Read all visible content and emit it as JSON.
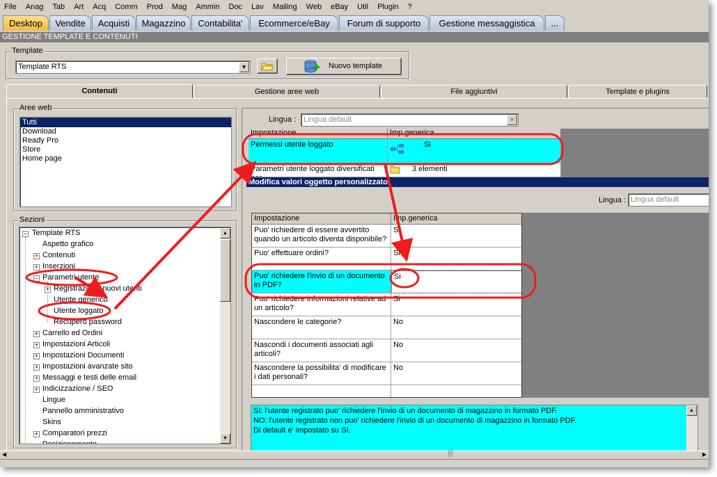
{
  "menu": [
    "File",
    "Anag",
    "Tab",
    "Art",
    "Acq",
    "Comm",
    "Prod",
    "Mag",
    "Ammin",
    "Doc",
    "Lav",
    "Mailing",
    "Web",
    "eBay",
    "Util",
    "Plugin",
    "?"
  ],
  "tabs": [
    "Desktop",
    "Vendite",
    "Acquisti",
    "Magazzino",
    "Contabilita'",
    "Ecommerce/eBay",
    "Forum di supporto",
    "Gestione messaggistica",
    "..."
  ],
  "section_title": "GESTIONE TEMPLATE E CONTENUTI",
  "template": {
    "legend": "Template",
    "value": "Template RTS",
    "new_button": "Nuovo template"
  },
  "page_tabs": [
    "Contenuti",
    "Gestione aree web",
    "File aggiuntivi",
    "Template e plugins"
  ],
  "aree_web": {
    "legend": "Aree web",
    "items": [
      "Tutti",
      "Download",
      "Ready Pro",
      "Store",
      "Home page"
    ]
  },
  "sezioni": {
    "legend": "Sezioni",
    "root": "Template RTS",
    "nodes": [
      "Aspetto grafico",
      "Contenuti",
      "Inserzioni",
      "Parametri utente",
      "Registrazione nuovi utenti",
      "Utente generico",
      "Utente loggato",
      "Recupero password",
      "Carrello ed Ordini",
      "Impostazioni Articoli",
      "Impostazioni Documenti",
      "Impostazioni avanzate sito",
      "Messaggi e testi delle email",
      "Indicizzazione / SEO",
      "Lingue",
      "Pannello amministrativo",
      "Skins",
      "Comparatori prezzi",
      "Posizionamento"
    ]
  },
  "upper": {
    "lingua_label": "Lingua :",
    "lingua_value": "Lingua default",
    "headers": [
      "Impostazione",
      "Imp.generica"
    ],
    "rows": [
      {
        "name": "Permessi utente loggato",
        "value": "Si"
      },
      {
        "name": "Parametri utente loggato diversificati per",
        "value": "3 elementi"
      }
    ]
  },
  "dialog": {
    "title": "Modifica valori oggetto personalizzato",
    "lingua_label": "Lingua :",
    "lingua_value": "Lingua default",
    "headers": [
      "Impostazione",
      "Imp.generica"
    ],
    "rows": [
      {
        "name": "Puo' richiedere di essere avvertito quando un articolo diventa disponibile?",
        "value": "Si"
      },
      {
        "name": "Puo' effettuare ordini?",
        "value": "Si"
      },
      {
        "name": "Puo' richiedere l'invio di un documento in PDF?",
        "value": "Si"
      },
      {
        "name": "Puo' richiedere informazioni relative ad un articolo?",
        "value": "Si"
      },
      {
        "name": "Nascondere le categorie?",
        "value": "No"
      },
      {
        "name": "Nascondi i documenti associati agli articoli?",
        "value": "No"
      },
      {
        "name": "Nascondere la possibilita' di modificare i dati personali?",
        "value": "No"
      }
    ],
    "description": [
      "SI: l'utente registrato puo' richiedere l'invio di un documento di magazzino in formato PDF.",
      "NO: l'utente registrato non puo' richiedere l'invio di un documento di magazzino in formato PDF.",
      "Di default e' impostato su SI."
    ]
  },
  "colors": {
    "highlight": "#00ffff",
    "selection": "#0a246a",
    "annotation": "#ee1c1c",
    "active_tab": "#f5b93e"
  }
}
